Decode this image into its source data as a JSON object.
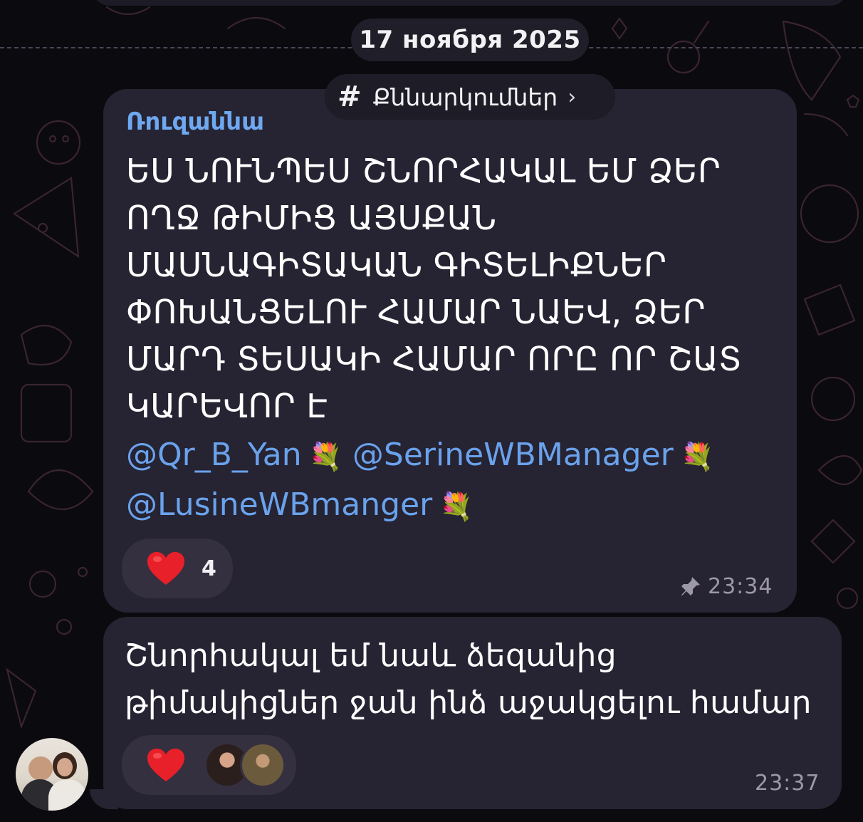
{
  "date_separator": "17 ноября 2025",
  "topic": {
    "hash": "#",
    "label": "Քննարկումներ",
    "chevron": "›"
  },
  "message1": {
    "sender": "Ռուզաննա",
    "text": "ԵՍ ՆՈՒՆՊԵՍ ՇՆՈՐՀԱԿԱԼ ԵՄ ՁԵՐ ՈՂՋ ԹԻՄԻՑ ԱՅՍՔԱՆ ՄԱՍՆԱԳԻՏԱԿԱՆ ԳԻՏԵԼԻՔՆԵՐ ՓՈԽԱՆՑԵԼՈՒ ՀԱՄԱՐ ՆԱԵՎ, ՁԵՐ ՄԱՐԴ ՏԵՍԱԿԻ ՀԱՄԱՐ ՈՐԸ ՈՐ ՇԱՏ ԿԱՐԵՎՈՐ Է",
    "mentions": [
      "@Qr_B_Yan",
      "@SerineWBManager",
      "@LusineWBmanger"
    ],
    "flower_emoji": "💐",
    "reaction": {
      "icon": "heart-icon",
      "count": "4"
    },
    "pinned_icon": "pin-icon",
    "time": "23:34"
  },
  "message2": {
    "text": "Շնորհակալ եմ նաև ձեզանից թիմակիցներ ջան ինձ աջակցելու համար",
    "reaction": {
      "icon": "heart-icon",
      "reactor_avatars": 2
    },
    "time": "23:37"
  },
  "colors": {
    "background": "#0b0a0f",
    "bubble": "#262332",
    "sender_name": "#6ea8f0",
    "mention": "#6aa2ec",
    "heart": "#e8202a",
    "time": "#9c98a8"
  }
}
